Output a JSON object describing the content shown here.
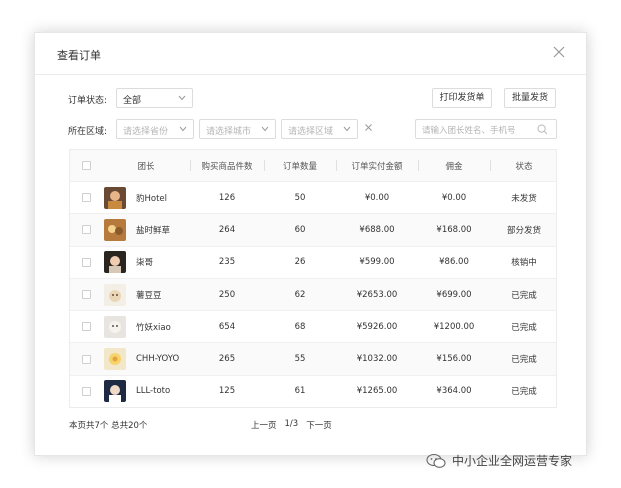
{
  "modal": {
    "title": "查看订单"
  },
  "filters": {
    "status_label": "订单状态:",
    "status_value": "全部",
    "region_label": "所在区域:",
    "province_placeholder": "请选择省份",
    "city_placeholder": "请选择城市",
    "district_placeholder": "请选择区域",
    "search_placeholder": "请输入团长姓名、手机号"
  },
  "actions": {
    "print_label": "打印发货单",
    "batch_ship_label": "批量发货"
  },
  "table": {
    "headers": [
      "团长",
      "购买商品件数",
      "订单数量",
      "订单实付金额",
      "佣金",
      "状态"
    ],
    "rows": [
      {
        "leader": "豹Hotel",
        "items": "126",
        "orders": "50",
        "paid": "¥0.00",
        "commission": "¥0.00",
        "status": "未发货"
      },
      {
        "leader": "盐时鲜草",
        "items": "264",
        "orders": "60",
        "paid": "¥688.00",
        "commission": "¥168.00",
        "status": "部分发货"
      },
      {
        "leader": "柒哥",
        "items": "235",
        "orders": "26",
        "paid": "¥599.00",
        "commission": "¥86.00",
        "status": "核销中"
      },
      {
        "leader": "薯豆豆",
        "items": "250",
        "orders": "62",
        "paid": "¥2653.00",
        "commission": "¥699.00",
        "status": "已完成"
      },
      {
        "leader": "竹妖xiao",
        "items": "654",
        "orders": "68",
        "paid": "¥5926.00",
        "commission": "¥1200.00",
        "status": "已完成"
      },
      {
        "leader": "CHH-YOYO",
        "items": "265",
        "orders": "55",
        "paid": "¥1032.00",
        "commission": "¥156.00",
        "status": "已完成"
      },
      {
        "leader": "LLL-toto",
        "items": "125",
        "orders": "61",
        "paid": "¥1265.00",
        "commission": "¥364.00",
        "status": "已完成"
      }
    ]
  },
  "footer": {
    "summary": "本页共7个  总共20个",
    "prev": "上一页",
    "page": "1/3",
    "next": "下一页"
  },
  "watermark": "中小企业全网运营专家",
  "colors": {
    "border": "#dcdcdc",
    "header_bg": "#fafafa",
    "text": "#333333",
    "placeholder": "#b5b5b5"
  }
}
